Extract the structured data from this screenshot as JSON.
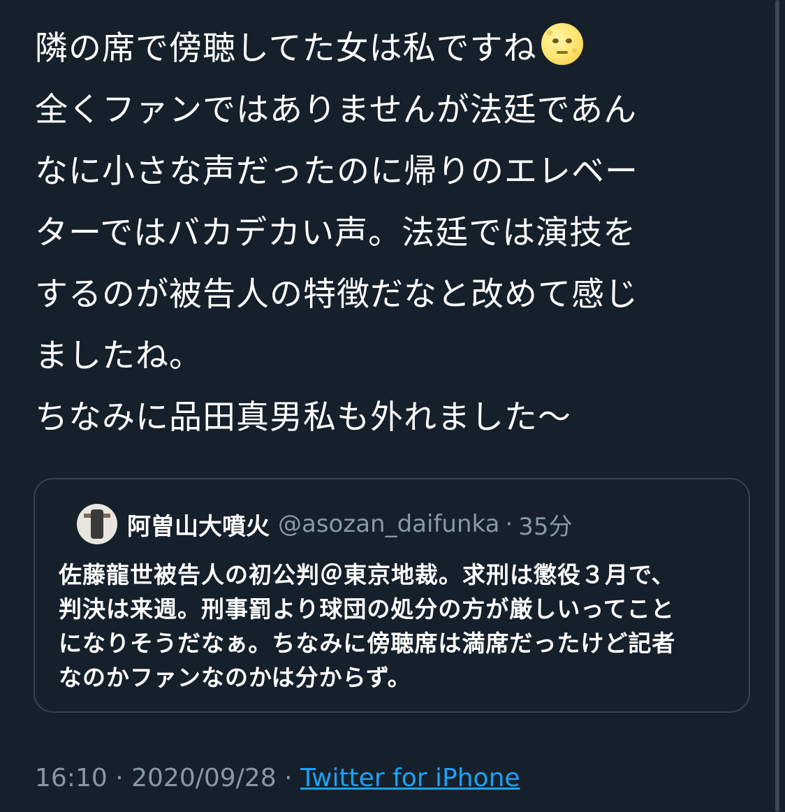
{
  "tweet": {
    "lines": [
      "隣の席で傍聴してた女は私ですね",
      "全くファンではありませんが法廷であん",
      "なに小さな声だったのに帰りのエレベー",
      "ターではバカデカい声。法廷では演技を",
      "するのが被告人の特徴だなと改めて感じ",
      "ましたね。",
      "ちなみに品田真男私も外れました〜"
    ],
    "emoji": "full-moon-face"
  },
  "quote": {
    "name": "阿曽山大噴火",
    "handle": "@asozan_daifunka",
    "separator": "·",
    "time": "35分",
    "lines": [
      "佐藤龍世被告人の初公判＠東京地裁。求刑は懲役３月で、",
      "判決は来週。刑事罰より球団の処分の方が厳しいってこと",
      "になりそうだなぁ。ちなみに傍聴席は満席だったけど記者",
      "なのかファンなのかは分からず。"
    ]
  },
  "meta": {
    "time": "16:10",
    "separator1": "·",
    "date": "2020/09/28",
    "separator2": "·",
    "source": "Twitter for iPhone"
  },
  "colors": {
    "background": "#15202b",
    "text": "#ffffff",
    "secondary": "#8899a6",
    "link": "#1da1f2",
    "border": "#38444d"
  }
}
